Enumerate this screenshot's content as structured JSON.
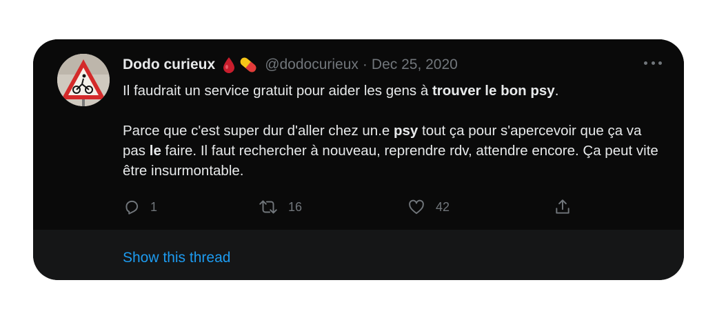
{
  "tweet": {
    "author_name": "Dodo curieux",
    "handle": "@dodocurieux",
    "separator": "·",
    "date": "Dec 25, 2020",
    "paragraph1": {
      "before": "Il faudrait un service gratuit pour aider les gens à ",
      "bold": "trouver le bon psy",
      "after": "."
    },
    "paragraph2": {
      "part1": "Parce que c'est super dur d'aller chez un.e ",
      "bold1": "psy",
      "part2": " tout ça pour s'apercevoir que ça va pas ",
      "bold2": "le",
      "part3": " faire. Il faut rechercher à nouveau, reprendre rdv, attendre encore. Ça peut vite être insurmontable."
    },
    "emoji_icons": [
      "drop-of-blood-icon",
      "pill-icon"
    ]
  },
  "actions": {
    "reply_count": "1",
    "retweet_count": "16",
    "like_count": "42"
  },
  "footer": {
    "show_thread_label": "Show this thread"
  },
  "colors": {
    "card_bg": "#0a0a0a",
    "footer_bg": "#151617",
    "text": "#e7e9ea",
    "muted": "#71767b",
    "link": "#1d9bf0"
  }
}
